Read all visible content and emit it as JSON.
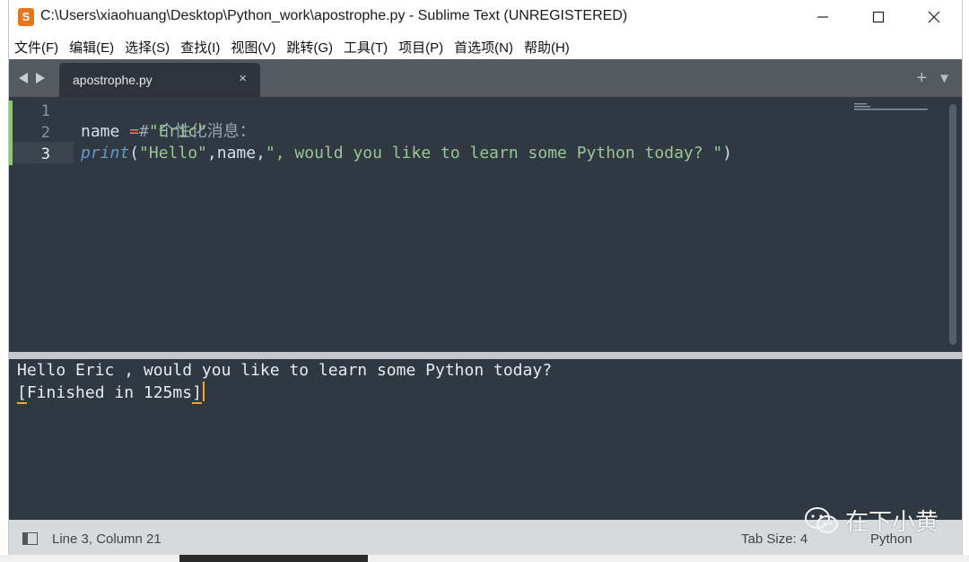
{
  "window": {
    "title": "C:\\Users\\xiaohuang\\Desktop\\Python_work\\apostrophe.py - Sublime Text (UNREGISTERED)",
    "app_icon_glyph": "S"
  },
  "menu": [
    "文件(F)",
    "编辑(E)",
    "选择(S)",
    "查找(I)",
    "视图(V)",
    "跳转(G)",
    "工具(T)",
    "项目(P)",
    "首选项(N)",
    "帮助(H)"
  ],
  "tab": {
    "label": "apostrophe.py",
    "close": "×",
    "add": "+",
    "dropdown": "▼"
  },
  "editor": {
    "line_numbers": [
      "1",
      "2",
      "3"
    ],
    "current_line": 3,
    "line1": {
      "comment": "# 个性化消息："
    },
    "line2": {
      "name": "name",
      "op": " = ",
      "str": "\"Eric\""
    },
    "line3": {
      "kw": "print",
      "open": "(",
      "str1": "\"Hello\"",
      "sep1": ",name,",
      "str2": "\", would you like to learn some Python today? \"",
      "close": ")"
    }
  },
  "output": {
    "line1": "Hello Eric , would you like to learn some Python today?",
    "line2_open": "[",
    "line2_body": "Finished in 125ms",
    "line2_close": "]"
  },
  "status": {
    "position": "Line 3, Column 21",
    "tab_size": "Tab Size: 4",
    "syntax": "Python"
  },
  "watermark": {
    "text": "在下小黄"
  },
  "colors": {
    "editor_bg": "#303841",
    "tabbar_bg": "#555a61",
    "keyword": "#6699cc",
    "string": "#99c794",
    "operator": "#f97b58",
    "status_bg": "#d7dadd"
  }
}
